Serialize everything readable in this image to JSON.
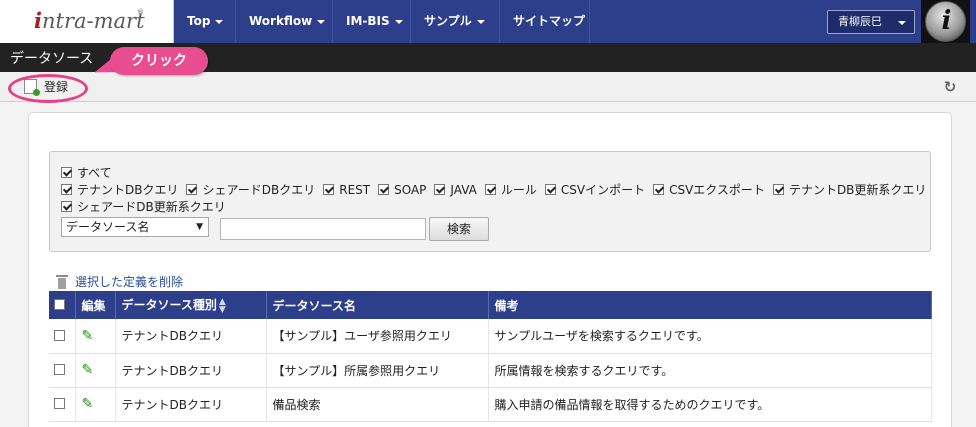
{
  "app": {
    "logo_text": "intra-mart",
    "logo_sup": "®",
    "nav": [
      {
        "label": "Top"
      },
      {
        "label": "Workflow"
      },
      {
        "label": "IM-BIS"
      },
      {
        "label": "サンプル"
      },
      {
        "label": "サイトマップ"
      }
    ],
    "user_name": "青柳辰巳",
    "avatar_letter": "i"
  },
  "page": {
    "title": "データソース",
    "register_label": "登録",
    "callout_label": "クリック"
  },
  "search": {
    "checkbox_all": {
      "label": "すべて",
      "checked": true
    },
    "checkboxes": [
      {
        "label": "テナントDBクエリ",
        "checked": true
      },
      {
        "label": "シェアードDBクエリ",
        "checked": true
      },
      {
        "label": "REST",
        "checked": true
      },
      {
        "label": "SOAP",
        "checked": true
      },
      {
        "label": "JAVA",
        "checked": true
      },
      {
        "label": "ルール",
        "checked": true
      },
      {
        "label": "CSVインポート",
        "checked": true
      },
      {
        "label": "CSVエクスポート",
        "checked": true
      },
      {
        "label": "テナントDB更新系クエリ",
        "checked": true
      }
    ],
    "checkbox_last": {
      "label": "シェアードDB更新系クエリ",
      "checked": true
    },
    "select_value": "データソース名",
    "select_arrow": "▼",
    "input_value": "",
    "search_button": "検索"
  },
  "actions": {
    "delete_selected": "選択した定義を削除"
  },
  "table": {
    "headers": {
      "edit": "編集",
      "type": "データソース種別",
      "name": "データソース名",
      "note": "備考"
    },
    "sort_glyph": "▲▼",
    "rows": [
      {
        "type": "テナントDBクエリ",
        "name": "【サンプル】ユーザ参照用クエリ",
        "note": "サンプルユーザを検索するクエリです。"
      },
      {
        "type": "テナントDBクエリ",
        "name": "【サンプル】所属参照用クエリ",
        "note": "所属情報を検索するクエリです。"
      },
      {
        "type": "テナントDBクエリ",
        "name": "備品検索",
        "note": "購入申請の備品情報を取得するためのクエリです。"
      }
    ]
  },
  "icons": {
    "refresh": "refresh-icon",
    "pencil": "pencil-icon",
    "trash": "trash-icon",
    "document_add": "document-add-icon"
  },
  "colors": {
    "nav_bg": "#2d3e8a",
    "title_bar": "#222222",
    "callout": "#e84d90",
    "link": "#2a4f9a",
    "edit_icon": "#2f8a22"
  }
}
